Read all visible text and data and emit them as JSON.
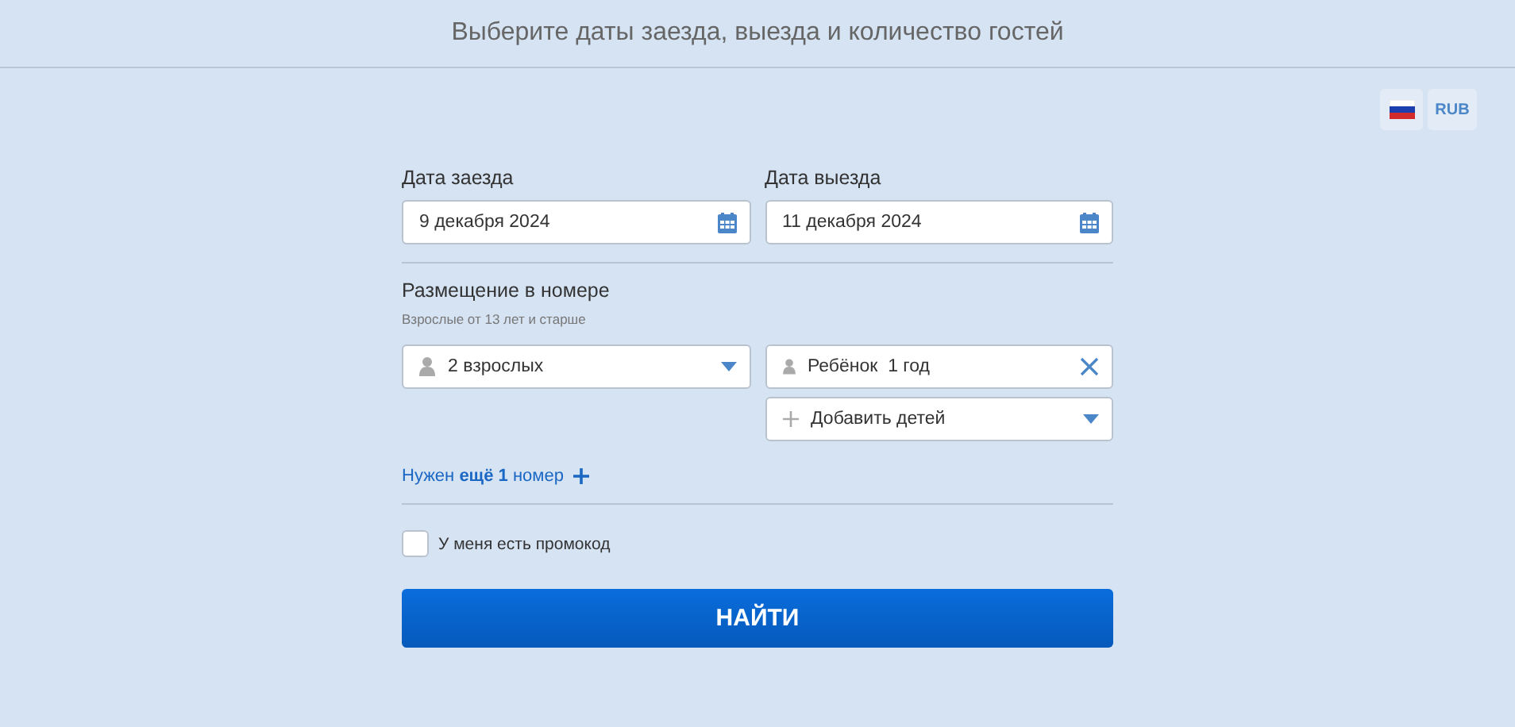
{
  "header": {
    "title": "Выберите даты заезда, выезда и количество гостей"
  },
  "locale": {
    "currency": "RUB"
  },
  "dates": [
    {
      "label": "Дата заезда",
      "value": "9 декабря 2024"
    },
    {
      "label": "Дата выезда",
      "value": "11 декабря 2024"
    }
  ],
  "room": {
    "title": "Размещение в номере",
    "hint": "Взрослые от 13 лет и старше",
    "adults": "2 взрослых",
    "children": [
      {
        "label": "Ребёнок  1 год"
      }
    ],
    "add_children": "Добавить детей"
  },
  "add_room": "Нужен **ещё 1** номер",
  "promo": {
    "label": "У меня есть промокод",
    "checked": false
  },
  "search_button": "НАЙТИ"
}
